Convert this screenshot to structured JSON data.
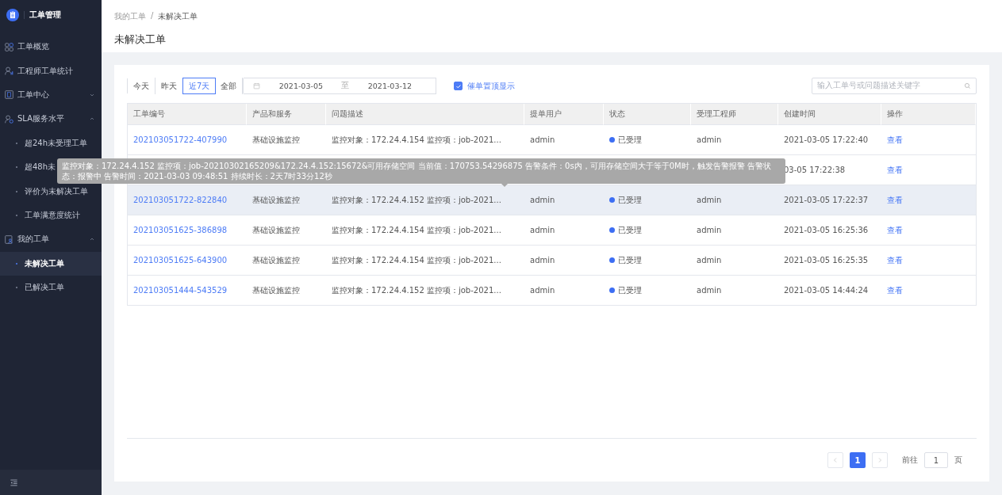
{
  "sidebar": {
    "logo_title": "工单管理",
    "items": [
      {
        "label": "工单概览",
        "selected": false
      },
      {
        "label": "工程师工单统计",
        "selected": false
      },
      {
        "label": "工单中心",
        "selected": false,
        "expanded": false
      },
      {
        "label": "SLA服务水平",
        "selected": false,
        "expanded": true,
        "children": [
          {
            "label": "超24h未受理工单",
            "selected": false
          },
          {
            "label": "超48h未",
            "selected": false
          },
          {
            "label": "评价为未解决工单",
            "selected": false
          },
          {
            "label": "工单满意度统计",
            "selected": false
          }
        ]
      },
      {
        "label": "我的工单",
        "selected": false,
        "expanded": true,
        "children": [
          {
            "label": "未解决工单",
            "selected": true
          },
          {
            "label": "已解决工单",
            "selected": false
          }
        ]
      }
    ]
  },
  "breadcrumb": [
    "我的工单",
    "/",
    "未解决工单"
  ],
  "page_title": "未解决工单",
  "filters": {
    "periods": [
      {
        "label": "今天",
        "selected": false
      },
      {
        "label": "昨天",
        "selected": false
      },
      {
        "label": "近7天",
        "selected": true
      },
      {
        "label": "全部",
        "selected": false
      }
    ],
    "date_from": "2021-03-05",
    "date_separator": "至",
    "date_to": "2021-03-12",
    "pin_urged": {
      "label": "催单置顶显示",
      "checked": true
    },
    "search": {
      "placeholder": "输入工单号或问题描述关键字"
    }
  },
  "table": {
    "columns": [
      "工单编号",
      "产品和服务",
      "问题描述",
      "提单用户",
      "状态",
      "受理工程师",
      "创建时间",
      "操作"
    ],
    "rows": [
      {
        "id": "202103051722-407990",
        "product": "基础设施监控",
        "description": "监控对象：172.24.4.154 监控项：job-2021...",
        "user": "admin",
        "status": "已受理",
        "engineer": "admin",
        "created": "2021-03-05 17:22:40",
        "action": "查看",
        "highlighted": false
      },
      {
        "created": "03-05 17:22:38",
        "action": "查看",
        "highlighted": false
      },
      {
        "id": "202103051722-822840",
        "product": "基础设施监控",
        "description": "监控对象：172.24.4.152 监控项：job-2021...",
        "user": "admin",
        "status": "已受理",
        "engineer": "admin",
        "created": "2021-03-05 17:22:37",
        "action": "查看",
        "highlighted": true
      },
      {
        "id": "202103051625-386898",
        "product": "基础设施监控",
        "description": "监控对象：172.24.4.154 监控项：job-2021...",
        "user": "admin",
        "status": "已受理",
        "engineer": "admin",
        "created": "2021-03-05 16:25:36",
        "action": "查看",
        "highlighted": false
      },
      {
        "id": "202103051625-643900",
        "product": "基础设施监控",
        "description": "监控对象：172.24.4.154 监控项：job-2021...",
        "user": "admin",
        "status": "已受理",
        "engineer": "admin",
        "created": "2021-03-05 16:25:35",
        "action": "查看",
        "highlighted": false
      },
      {
        "id": "202103051444-543529",
        "product": "基础设施监控",
        "description": "监控对象：172.24.4.152 监控项：job-2021...",
        "user": "admin",
        "status": "已受理",
        "engineer": "admin",
        "created": "2021-03-05 14:44:24",
        "action": "查看",
        "highlighted": false
      }
    ],
    "tooltip": "监控对象：172.24.4.152 监控项：job-20210302165209&172.24.4.152:15672&可用存储空间 当前值：170753.54296875 告警条件：0s内，可用存储空间大于等于0M时，触发告警报警 告警状态：报警中 告警时间：2021-03-03 09:48:51 持续时长：2天7时33分12秒"
  },
  "pagination": {
    "pages": [
      {
        "label": "1",
        "selected": true
      }
    ],
    "goto_label": "前往",
    "goto_value": "1",
    "page_unit": "页"
  }
}
